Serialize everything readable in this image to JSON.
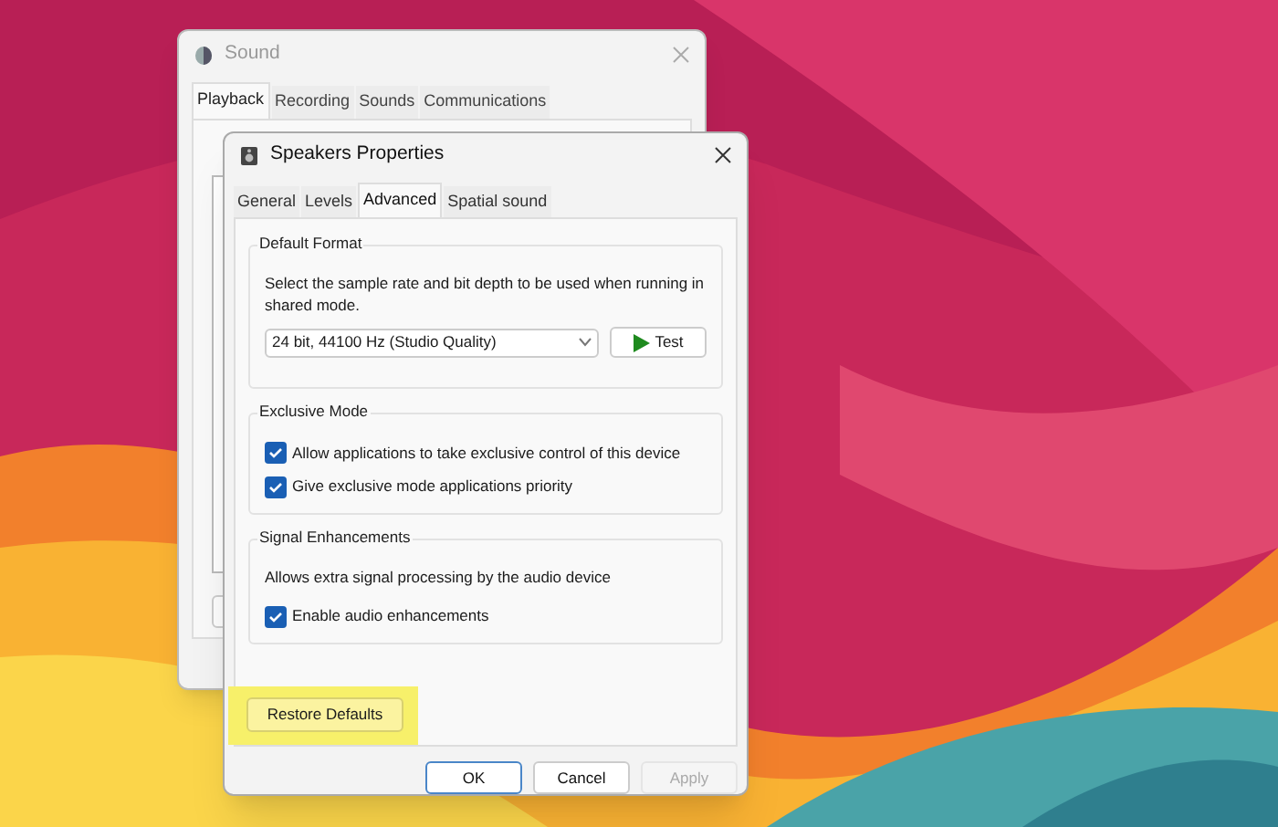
{
  "sound_window": {
    "title": "Sound",
    "tabs": [
      {
        "label": "Playback",
        "selected": true
      },
      {
        "label": "Recording",
        "selected": false
      },
      {
        "label": "Sounds",
        "selected": false
      },
      {
        "label": "Communications",
        "selected": false
      }
    ]
  },
  "properties_window": {
    "title": "Speakers Properties",
    "tabs": [
      {
        "label": "General",
        "selected": false
      },
      {
        "label": "Levels",
        "selected": false
      },
      {
        "label": "Advanced",
        "selected": true
      },
      {
        "label": "Spatial sound",
        "selected": false
      }
    ],
    "default_format": {
      "title": "Default Format",
      "description": "Select the sample rate and bit depth to be used when running in shared mode.",
      "format_value": "24 bit, 44100 Hz (Studio Quality)",
      "test_button": "Test"
    },
    "exclusive_mode": {
      "title": "Exclusive Mode",
      "options": [
        {
          "label": "Allow applications to take exclusive control of this device",
          "checked": true
        },
        {
          "label": "Give exclusive mode applications priority",
          "checked": true
        }
      ]
    },
    "signal_enhancements": {
      "title": "Signal Enhancements",
      "description": "Allows extra signal processing by the audio device",
      "options": [
        {
          "label": "Enable audio enhancements",
          "checked": true
        }
      ]
    },
    "restore_button": {
      "label": "Restore Defaults",
      "highlighted": true
    },
    "buttons": [
      {
        "label": "OK",
        "disabled": false,
        "default": true
      },
      {
        "label": "Cancel",
        "disabled": false,
        "default": false
      },
      {
        "label": "Apply",
        "disabled": true,
        "default": false
      }
    ]
  }
}
